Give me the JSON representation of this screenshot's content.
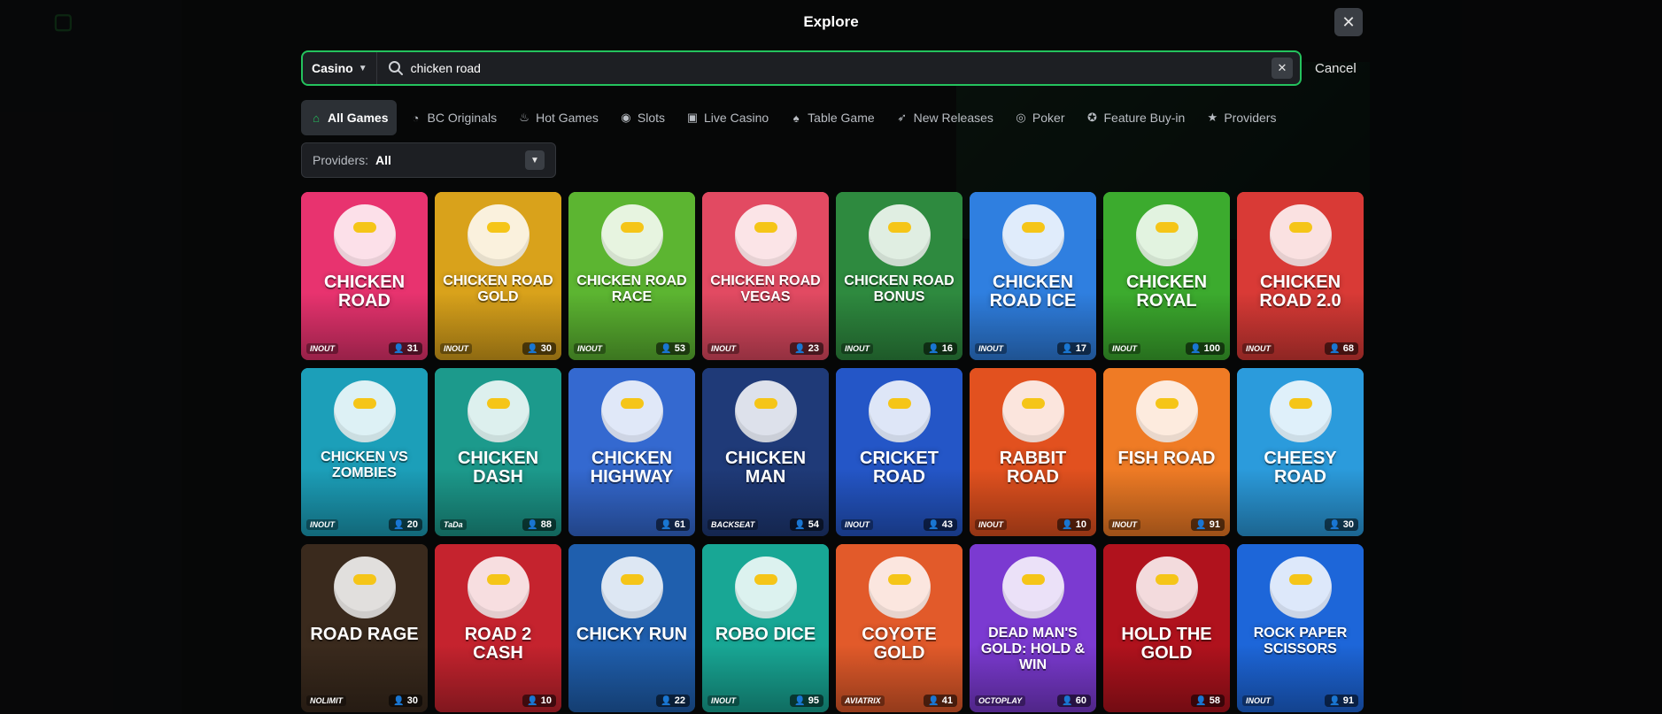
{
  "modal": {
    "title": "Explore"
  },
  "search": {
    "category": "Casino",
    "value": "chicken road",
    "cancel_label": "Cancel"
  },
  "tabs": [
    {
      "label": "All Games",
      "icon": "home-icon",
      "active": true
    },
    {
      "label": "BC Originals",
      "icon": "originals-icon"
    },
    {
      "label": "Hot Games",
      "icon": "flame-icon"
    },
    {
      "label": "Slots",
      "icon": "slots-icon"
    },
    {
      "label": "Live Casino",
      "icon": "live-icon"
    },
    {
      "label": "Table Game",
      "icon": "cards-icon"
    },
    {
      "label": "New Releases",
      "icon": "rocket-icon"
    },
    {
      "label": "Poker",
      "icon": "poker-chip-icon"
    },
    {
      "label": "Feature Buy-in",
      "icon": "star-badge-icon"
    },
    {
      "label": "Providers",
      "icon": "star-icon"
    }
  ],
  "providers_filter": {
    "label": "Providers:",
    "value": "All"
  },
  "games": [
    {
      "title": "Chicken Road",
      "brand": "INOUT",
      "players": "31",
      "bg": "#e8336f"
    },
    {
      "title": "Chicken Road Gold",
      "brand": "INOUT",
      "players": "30",
      "bg": "#d9a21b"
    },
    {
      "title": "Chicken Road Race",
      "brand": "INOUT",
      "players": "53",
      "bg": "#5cb531"
    },
    {
      "title": "Chicken Road Vegas",
      "brand": "INOUT",
      "players": "23",
      "bg": "#e24a62"
    },
    {
      "title": "Chicken Road Bonus",
      "brand": "INOUT",
      "players": "16",
      "bg": "#2e8a3f"
    },
    {
      "title": "Chicken Road Ice",
      "brand": "INOUT",
      "players": "17",
      "bg": "#2f7fe0"
    },
    {
      "title": "Chicken Royal",
      "brand": "INOUT",
      "players": "100",
      "bg": "#3cab2e"
    },
    {
      "title": "Chicken Road 2.0",
      "brand": "INOUT",
      "players": "68",
      "bg": "#d93a36"
    },
    {
      "title": "Chicken vs Zombies",
      "brand": "INOUT",
      "players": "20",
      "bg": "#1c9fb9"
    },
    {
      "title": "Chicken Dash",
      "brand": "TaDa",
      "players": "88",
      "bg": "#1c9a8c"
    },
    {
      "title": "Chicken Highway",
      "brand": "",
      "players": "61",
      "bg": "#3469d0"
    },
    {
      "title": "Chicken Man",
      "brand": "BACKSEAT",
      "players": "54",
      "bg": "#1f3a78"
    },
    {
      "title": "Cricket Road",
      "brand": "INOUT",
      "players": "43",
      "bg": "#2456c7"
    },
    {
      "title": "Rabbit Road",
      "brand": "INOUT",
      "players": "10",
      "bg": "#e2511f"
    },
    {
      "title": "Fish Road",
      "brand": "INOUT",
      "players": "91",
      "bg": "#ef7b25"
    },
    {
      "title": "Cheesy Road",
      "brand": "",
      "players": "30",
      "bg": "#2b9bdc"
    },
    {
      "title": "Road Rage",
      "brand": "NOLIMIT",
      "players": "30",
      "bg": "#3a2a1d"
    },
    {
      "title": "Road 2 Cash",
      "brand": "",
      "players": "10",
      "bg": "#c5232e"
    },
    {
      "title": "Chicky Run",
      "brand": "",
      "players": "22",
      "bg": "#1f5fae"
    },
    {
      "title": "Robo Dice",
      "brand": "INOUT",
      "players": "95",
      "bg": "#18a795"
    },
    {
      "title": "Coyote Gold",
      "brand": "AVIATRIX",
      "players": "41",
      "bg": "#e25a2a"
    },
    {
      "title": "Dead Man's Gold: Hold & Win",
      "brand": "OCTOPLAY",
      "players": "60",
      "bg": "#7b3ad1"
    },
    {
      "title": "Hold the Gold",
      "brand": "",
      "players": "58",
      "bg": "#b0121d"
    },
    {
      "title": "Rock Paper Scissors",
      "brand": "INOUT",
      "players": "91",
      "bg": "#1d66d9"
    }
  ]
}
